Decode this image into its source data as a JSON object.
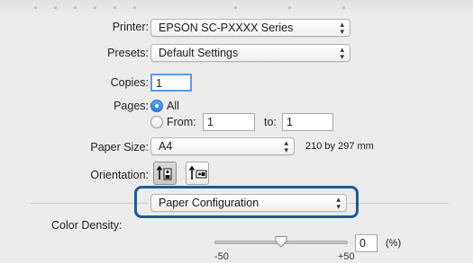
{
  "printer": {
    "label": "Printer:",
    "value": "EPSON SC-PXXXX Series"
  },
  "presets": {
    "label": "Presets:",
    "value": "Default Settings"
  },
  "copies": {
    "label": "Copies:",
    "value": "1"
  },
  "pages": {
    "label": "Pages:",
    "all_label": "All",
    "from_label": "From:",
    "from_value": "1",
    "to_label": "to:",
    "to_value": "1",
    "selected": "All"
  },
  "paper_size": {
    "label": "Paper Size:",
    "value": "A4",
    "dimensions": "210 by 297 mm"
  },
  "orientation": {
    "label": "Orientation:",
    "selected": "portrait"
  },
  "section_popup": {
    "value": "Paper Configuration"
  },
  "color_density": {
    "label": "Color Density:",
    "value": "0",
    "unit": "(%)",
    "min_label": "-50",
    "max_label": "+50",
    "slider_fraction": 0.5
  },
  "colors": {
    "highlight": "#1e5a96",
    "radio_on": "#2a7de1"
  }
}
